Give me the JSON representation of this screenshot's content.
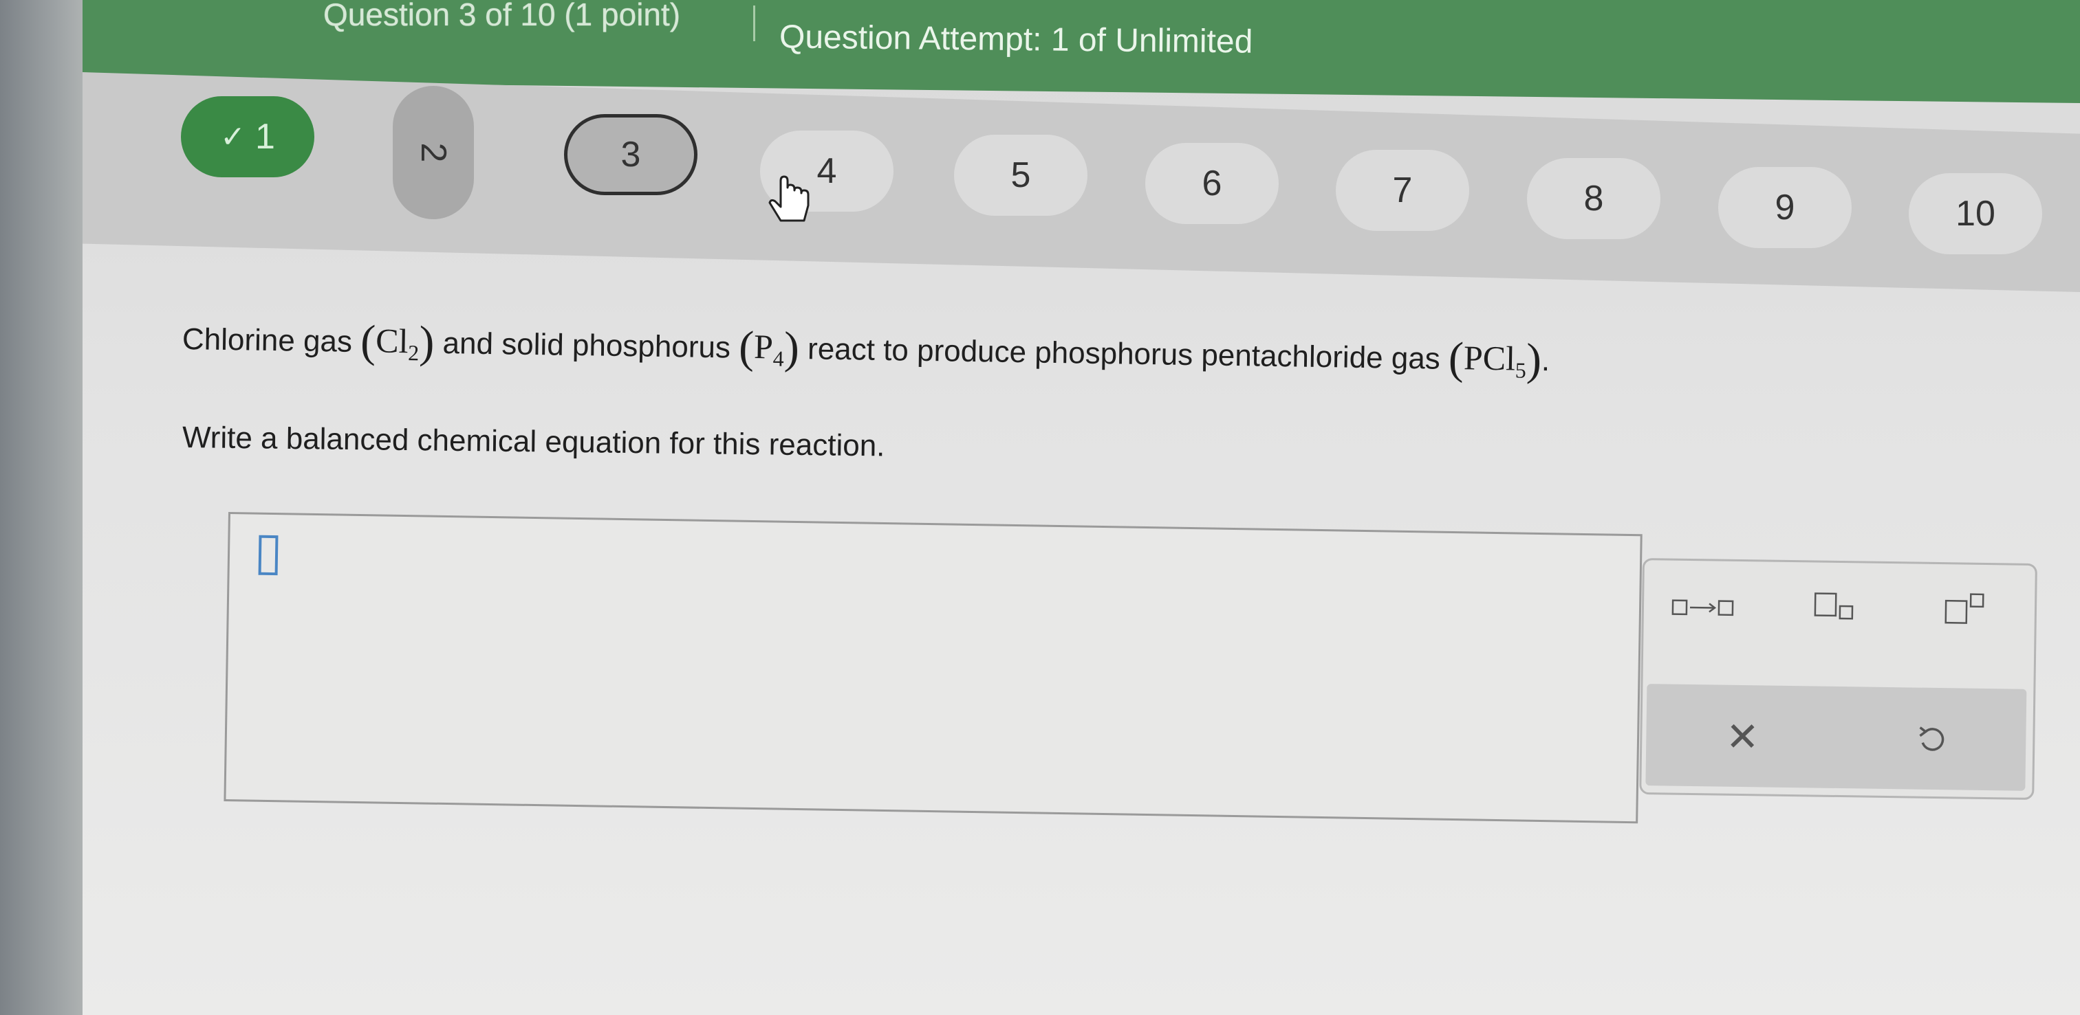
{
  "header": {
    "question_label": "Question 3 of 10 (1 point)",
    "attempt_label": "Question Attempt: 1 of Unlimited"
  },
  "nav": {
    "items": [
      {
        "label": "1",
        "state": "completed",
        "icon": "check-icon"
      },
      {
        "label": "2",
        "state": "visited"
      },
      {
        "label": "3",
        "state": "current"
      },
      {
        "label": "4",
        "state": "unvisited"
      },
      {
        "label": "5",
        "state": "unvisited"
      },
      {
        "label": "6",
        "state": "unvisited"
      },
      {
        "label": "7",
        "state": "unvisited"
      },
      {
        "label": "8",
        "state": "unvisited"
      },
      {
        "label": "9",
        "state": "unvisited"
      },
      {
        "label": "10",
        "state": "unvisited"
      }
    ],
    "check_glyph": "✓"
  },
  "question": {
    "part1": "Chlorine gas ",
    "cl_symbol": "Cl",
    "cl_sub": "2",
    "part2": " and solid phosphorus ",
    "p_symbol": "P",
    "p_sub": "4",
    "part3": " react to produce phosphorus pentachloride gas ",
    "pcl_symbol": "PCl",
    "pcl_sub": "5",
    "end": ".",
    "open_paren": "(",
    "close_paren": ")",
    "prompt": "Write a balanced chemical equation for this reaction."
  },
  "answer": {
    "value": ""
  },
  "palette": {
    "tools": [
      "arrow-reaction-icon",
      "subscript-icon",
      "superscript-icon"
    ],
    "clear_glyph": "✕",
    "undo_icon": "undo-icon"
  },
  "colors": {
    "header_green": "#4f8e59",
    "completed_green": "#3a8a45",
    "caret_blue": "#4a86c4"
  }
}
